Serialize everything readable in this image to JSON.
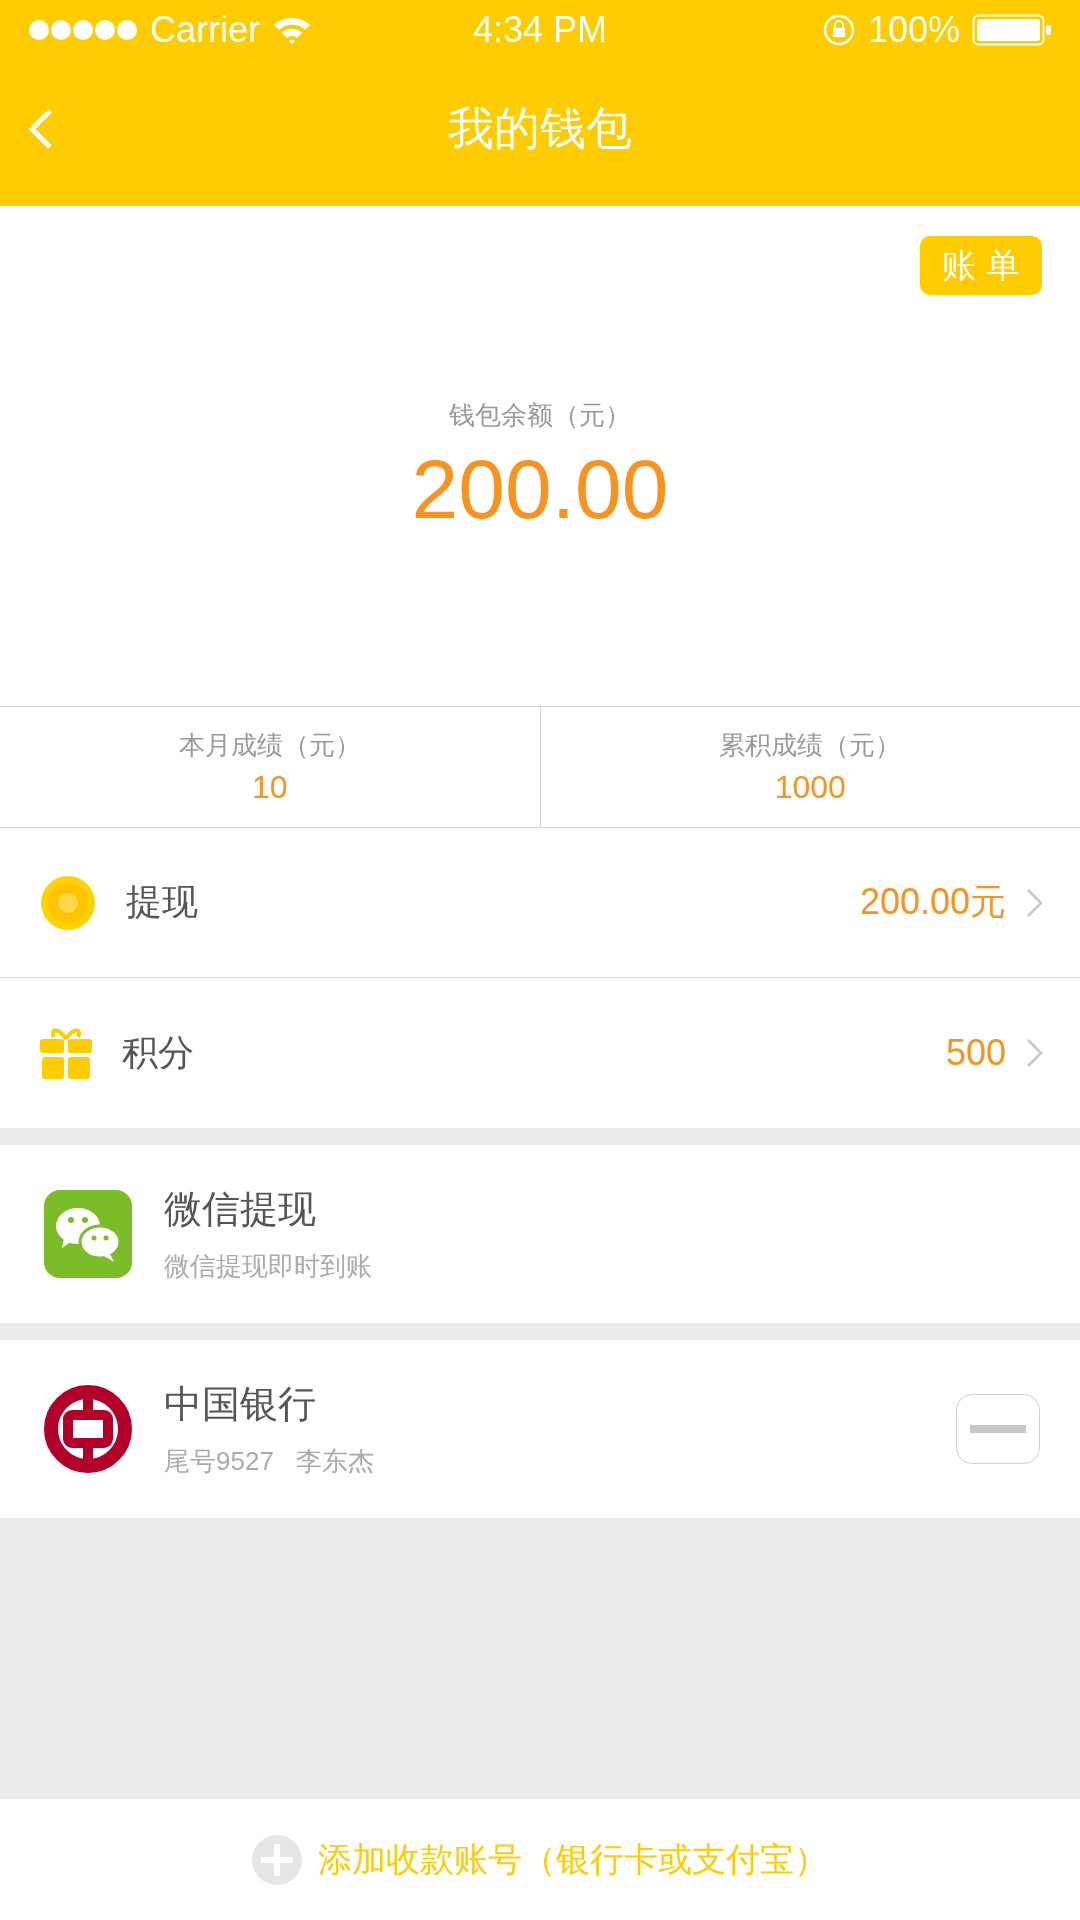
{
  "status_bar": {
    "carrier": "Carrier",
    "time": "4:34 PM",
    "battery": "100%"
  },
  "nav": {
    "title": "我的钱包"
  },
  "balance": {
    "bill_button": "账 单",
    "label": "钱包余额（元）",
    "amount": "200.00"
  },
  "stats": [
    {
      "label": "本月成绩（元）",
      "value": "10"
    },
    {
      "label": "累积成绩（元）",
      "value": "1000"
    }
  ],
  "menu": [
    {
      "kind": "coin",
      "label": "提现",
      "value": "200.00元"
    },
    {
      "kind": "gift",
      "label": "积分",
      "value": "500"
    }
  ],
  "accounts": [
    {
      "kind": "wechat",
      "name": "微信提现",
      "detail": "微信提现即时到账"
    },
    {
      "kind": "bank",
      "name": "中国银行",
      "detail": "尾号9527   李东杰",
      "removable": true
    }
  ],
  "footer": {
    "add_label": "添加收款账号（银行卡或支付宝）"
  }
}
